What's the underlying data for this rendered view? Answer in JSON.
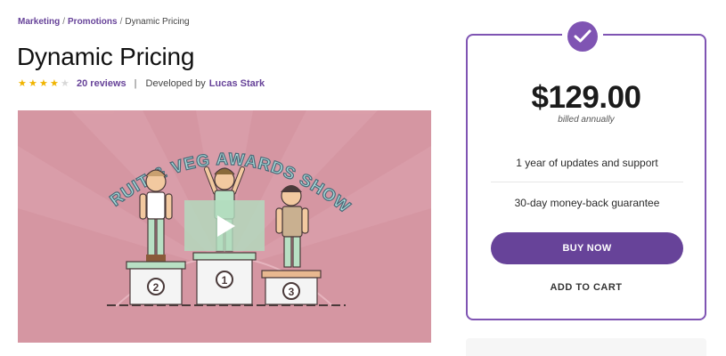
{
  "breadcrumb": {
    "items": [
      "Marketing",
      "Promotions"
    ],
    "separator": "/",
    "current": "Dynamic Pricing"
  },
  "product": {
    "title": "Dynamic Pricing",
    "rating": 4,
    "rating_max": 5,
    "reviews_label": "20 reviews",
    "divider": "|",
    "developed_by_label": "Developed by",
    "developer": "Lucas Stark"
  },
  "video": {
    "banner_text": "FRUIT & VEG AWARDS SHOW",
    "podium_numbers": [
      "2",
      "1",
      "3"
    ],
    "play_icon": "play-icon",
    "background_color": "#d596a2"
  },
  "pricing": {
    "check_icon": "checkmark-icon",
    "price": "$129.00",
    "billing": "billed annually",
    "features": [
      "1 year of updates and support",
      "30-day money-back guarantee"
    ],
    "buy_label": "BUY NOW",
    "cart_label": "ADD TO CART",
    "accent_color": "#7f54b3",
    "button_color": "#674399"
  }
}
